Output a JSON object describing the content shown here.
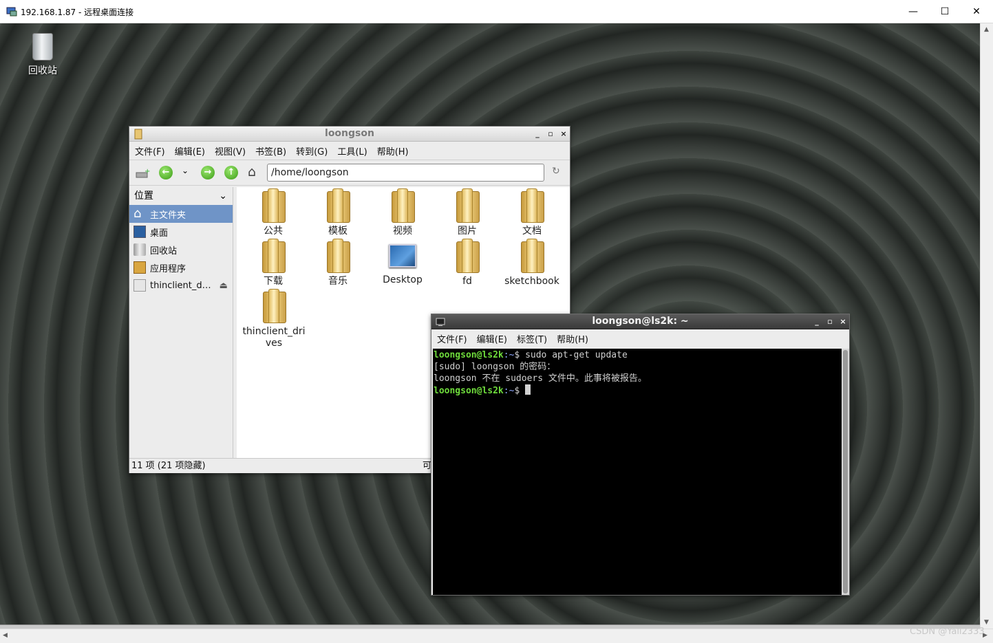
{
  "rdp": {
    "title": "192.168.1.87 - 远程桌面连接",
    "minimize": "—",
    "maximize": "☐",
    "close": "✕"
  },
  "desktop": {
    "trash_label": "回收站"
  },
  "file_manager": {
    "title": "loongson",
    "menu": [
      "文件(F)",
      "编辑(E)",
      "视图(V)",
      "书签(B)",
      "转到(G)",
      "工具(L)",
      "帮助(H)"
    ],
    "address": "/home/loongson",
    "side_header": "位置",
    "side_items": [
      "主文件夹",
      "桌面",
      "回收站",
      "应用程序",
      "thinclient_d…"
    ],
    "items": [
      "公共",
      "模板",
      "视频",
      "图片",
      "文档",
      "下载",
      "音乐",
      "Desktop",
      "fd",
      "sketchbook",
      "thinclient_drives"
    ],
    "status": "11 项 (21 项隐藏)",
    "status_right": "可"
  },
  "terminal": {
    "title": "loongson@ls2k: ~",
    "menu": [
      "文件(F)",
      "编辑(E)",
      "标签(T)",
      "帮助(H)"
    ],
    "prompt_user": "loongson@ls2k",
    "prompt_path": ":~",
    "prompt_symbol": "$ ",
    "command": "sudo apt-get update",
    "line2": "[sudo] loongson 的密码：",
    "line3": "loongson 不在 sudoers 文件中。此事将被报告。"
  },
  "watermark": "CSDN @Yali2333"
}
